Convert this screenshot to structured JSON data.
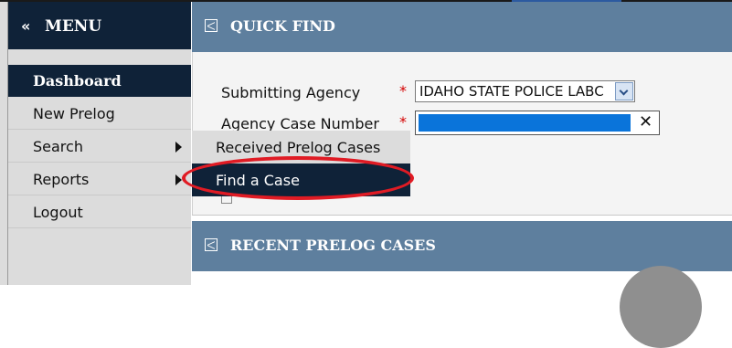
{
  "menu": {
    "collapse_glyph": "«",
    "title": "MENU",
    "items": [
      {
        "label": "Dashboard",
        "active": true,
        "submenu": false
      },
      {
        "label": "New Prelog",
        "active": false,
        "submenu": false
      },
      {
        "label": "Search",
        "active": false,
        "submenu": true
      },
      {
        "label": "Reports",
        "active": false,
        "submenu": true
      },
      {
        "label": "Logout",
        "active": false,
        "submenu": false
      }
    ]
  },
  "search_flyout": {
    "items": [
      {
        "label": "Received Prelog Cases",
        "highlighted": false
      },
      {
        "label": "Find a Case",
        "highlighted": true
      }
    ]
  },
  "quick_find": {
    "title": "QUICK FIND",
    "agency_label": "Submitting Agency",
    "agency_required": "*",
    "agency_value": "IDAHO STATE POLICE LABC",
    "case_label": "Agency Case Number",
    "case_required": "*",
    "case_clear": "✕"
  },
  "recent": {
    "title": "RECENT PRELOG CASES"
  },
  "colors": {
    "menu_dark": "#0f2238",
    "panel_header": "#5e7f9e",
    "annotation_red": "#e01b24",
    "selection_blue": "#0a74da"
  }
}
